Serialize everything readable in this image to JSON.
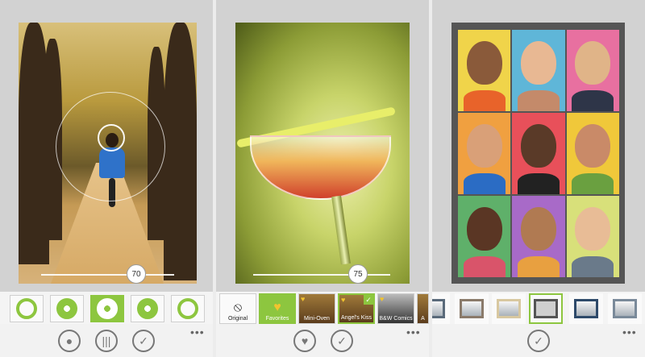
{
  "screen1": {
    "slider_value": "70",
    "aperture_tiles": [
      "aperture-icon",
      "aperture-icon",
      "aperture-icon",
      "aperture-icon",
      "aperture-icon"
    ],
    "selected_tile": 2,
    "appbar_icons": [
      "record-icon",
      "filter-bars-icon",
      "check-icon"
    ],
    "more": "•••"
  },
  "screen2": {
    "slider_value": "75",
    "filters": [
      {
        "label": "Original",
        "icon": "no-filter-icon"
      },
      {
        "label": "Favorites",
        "icon": "heart-icon"
      },
      {
        "label": "Mini-Oven",
        "icon": "thumbnail"
      },
      {
        "label": "Angel's Kiss",
        "icon": "thumbnail"
      },
      {
        "label": "B&W Comics",
        "icon": "thumbnail"
      },
      {
        "label": "A",
        "icon": "thumbnail"
      }
    ],
    "appbar_icons": [
      "heart-icon",
      "check-icon"
    ],
    "more": "•••"
  },
  "screen3": {
    "frames": [
      "frame-1",
      "frame-2",
      "frame-3",
      "frame-4",
      "frame-5",
      "frame-6"
    ],
    "selected_frame": 3,
    "appbar_icons": [
      "check-icon"
    ],
    "more": "•••"
  },
  "colors": {
    "accent": "#8dc63f",
    "bar": "#f2f2f2",
    "background": "#d2d2d2"
  }
}
